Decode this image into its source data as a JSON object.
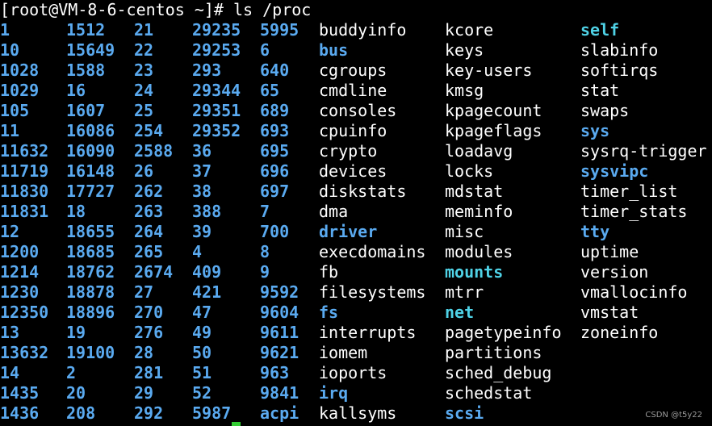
{
  "prompt": "[root@VM-8-6-centos ~]# ls /proc",
  "colors": {
    "directory": "#5aaaf0",
    "symlink": "#4fd2e6",
    "file": "#ffffff",
    "cursor": "#33cc33"
  },
  "rows": [
    [
      {
        "t": "1",
        "c": "blue"
      },
      {
        "t": "1512",
        "c": "blue"
      },
      {
        "t": "21",
        "c": "blue"
      },
      {
        "t": "29235",
        "c": "blue"
      },
      {
        "t": "5995",
        "c": "blue"
      },
      {
        "t": "buddyinfo",
        "c": "normal"
      },
      {
        "t": "kcore",
        "c": "normal"
      },
      {
        "t": "self",
        "c": "cyan"
      }
    ],
    [
      {
        "t": "10",
        "c": "blue"
      },
      {
        "t": "15649",
        "c": "blue"
      },
      {
        "t": "22",
        "c": "blue"
      },
      {
        "t": "29253",
        "c": "blue"
      },
      {
        "t": "6",
        "c": "blue"
      },
      {
        "t": "bus",
        "c": "blue"
      },
      {
        "t": "keys",
        "c": "normal"
      },
      {
        "t": "slabinfo",
        "c": "normal"
      }
    ],
    [
      {
        "t": "1028",
        "c": "blue"
      },
      {
        "t": "1588",
        "c": "blue"
      },
      {
        "t": "23",
        "c": "blue"
      },
      {
        "t": "293",
        "c": "blue"
      },
      {
        "t": "640",
        "c": "blue"
      },
      {
        "t": "cgroups",
        "c": "normal"
      },
      {
        "t": "key-users",
        "c": "normal"
      },
      {
        "t": "softirqs",
        "c": "normal"
      }
    ],
    [
      {
        "t": "1029",
        "c": "blue"
      },
      {
        "t": "16",
        "c": "blue"
      },
      {
        "t": "24",
        "c": "blue"
      },
      {
        "t": "29344",
        "c": "blue"
      },
      {
        "t": "65",
        "c": "blue"
      },
      {
        "t": "cmdline",
        "c": "normal"
      },
      {
        "t": "kmsg",
        "c": "normal"
      },
      {
        "t": "stat",
        "c": "normal"
      }
    ],
    [
      {
        "t": "105",
        "c": "blue"
      },
      {
        "t": "1607",
        "c": "blue"
      },
      {
        "t": "25",
        "c": "blue"
      },
      {
        "t": "29351",
        "c": "blue"
      },
      {
        "t": "689",
        "c": "blue"
      },
      {
        "t": "consoles",
        "c": "normal"
      },
      {
        "t": "kpagecount",
        "c": "normal"
      },
      {
        "t": "swaps",
        "c": "normal"
      }
    ],
    [
      {
        "t": "11",
        "c": "blue"
      },
      {
        "t": "16086",
        "c": "blue"
      },
      {
        "t": "254",
        "c": "blue"
      },
      {
        "t": "29352",
        "c": "blue"
      },
      {
        "t": "693",
        "c": "blue"
      },
      {
        "t": "cpuinfo",
        "c": "normal"
      },
      {
        "t": "kpageflags",
        "c": "normal"
      },
      {
        "t": "sys",
        "c": "blue"
      }
    ],
    [
      {
        "t": "11632",
        "c": "blue"
      },
      {
        "t": "16090",
        "c": "blue"
      },
      {
        "t": "2588",
        "c": "blue"
      },
      {
        "t": "36",
        "c": "blue"
      },
      {
        "t": "695",
        "c": "blue"
      },
      {
        "t": "crypto",
        "c": "normal"
      },
      {
        "t": "loadavg",
        "c": "normal"
      },
      {
        "t": "sysrq-trigger",
        "c": "normal"
      }
    ],
    [
      {
        "t": "11719",
        "c": "blue"
      },
      {
        "t": "16148",
        "c": "blue"
      },
      {
        "t": "26",
        "c": "blue"
      },
      {
        "t": "37",
        "c": "blue"
      },
      {
        "t": "696",
        "c": "blue"
      },
      {
        "t": "devices",
        "c": "normal"
      },
      {
        "t": "locks",
        "c": "normal"
      },
      {
        "t": "sysvipc",
        "c": "blue"
      }
    ],
    [
      {
        "t": "11830",
        "c": "blue"
      },
      {
        "t": "17727",
        "c": "blue"
      },
      {
        "t": "262",
        "c": "blue"
      },
      {
        "t": "38",
        "c": "blue"
      },
      {
        "t": "697",
        "c": "blue"
      },
      {
        "t": "diskstats",
        "c": "normal"
      },
      {
        "t": "mdstat",
        "c": "normal"
      },
      {
        "t": "timer_list",
        "c": "normal"
      }
    ],
    [
      {
        "t": "11831",
        "c": "blue"
      },
      {
        "t": "18",
        "c": "blue"
      },
      {
        "t": "263",
        "c": "blue"
      },
      {
        "t": "388",
        "c": "blue"
      },
      {
        "t": "7",
        "c": "blue"
      },
      {
        "t": "dma",
        "c": "normal"
      },
      {
        "t": "meminfo",
        "c": "normal"
      },
      {
        "t": "timer_stats",
        "c": "normal"
      }
    ],
    [
      {
        "t": "12",
        "c": "blue"
      },
      {
        "t": "18655",
        "c": "blue"
      },
      {
        "t": "264",
        "c": "blue"
      },
      {
        "t": "39",
        "c": "blue"
      },
      {
        "t": "700",
        "c": "blue"
      },
      {
        "t": "driver",
        "c": "blue"
      },
      {
        "t": "misc",
        "c": "normal"
      },
      {
        "t": "tty",
        "c": "blue"
      }
    ],
    [
      {
        "t": "1200",
        "c": "blue"
      },
      {
        "t": "18685",
        "c": "blue"
      },
      {
        "t": "265",
        "c": "blue"
      },
      {
        "t": "4",
        "c": "blue"
      },
      {
        "t": "8",
        "c": "blue"
      },
      {
        "t": "execdomains",
        "c": "normal"
      },
      {
        "t": "modules",
        "c": "normal"
      },
      {
        "t": "uptime",
        "c": "normal"
      }
    ],
    [
      {
        "t": "1214",
        "c": "blue"
      },
      {
        "t": "18762",
        "c": "blue"
      },
      {
        "t": "2674",
        "c": "blue"
      },
      {
        "t": "409",
        "c": "blue"
      },
      {
        "t": "9",
        "c": "blue"
      },
      {
        "t": "fb",
        "c": "normal"
      },
      {
        "t": "mounts",
        "c": "cyan"
      },
      {
        "t": "version",
        "c": "normal"
      }
    ],
    [
      {
        "t": "1230",
        "c": "blue"
      },
      {
        "t": "18878",
        "c": "blue"
      },
      {
        "t": "27",
        "c": "blue"
      },
      {
        "t": "421",
        "c": "blue"
      },
      {
        "t": "9592",
        "c": "blue"
      },
      {
        "t": "filesystems",
        "c": "normal"
      },
      {
        "t": "mtrr",
        "c": "normal"
      },
      {
        "t": "vmallocinfo",
        "c": "normal"
      }
    ],
    [
      {
        "t": "12350",
        "c": "blue"
      },
      {
        "t": "18896",
        "c": "blue"
      },
      {
        "t": "270",
        "c": "blue"
      },
      {
        "t": "47",
        "c": "blue"
      },
      {
        "t": "9604",
        "c": "blue"
      },
      {
        "t": "fs",
        "c": "blue"
      },
      {
        "t": "net",
        "c": "cyan"
      },
      {
        "t": "vmstat",
        "c": "normal"
      }
    ],
    [
      {
        "t": "13",
        "c": "blue"
      },
      {
        "t": "19",
        "c": "blue"
      },
      {
        "t": "276",
        "c": "blue"
      },
      {
        "t": "49",
        "c": "blue"
      },
      {
        "t": "9611",
        "c": "blue"
      },
      {
        "t": "interrupts",
        "c": "normal"
      },
      {
        "t": "pagetypeinfo",
        "c": "normal"
      },
      {
        "t": "zoneinfo",
        "c": "normal"
      }
    ],
    [
      {
        "t": "13632",
        "c": "blue"
      },
      {
        "t": "19100",
        "c": "blue"
      },
      {
        "t": "28",
        "c": "blue"
      },
      {
        "t": "50",
        "c": "blue"
      },
      {
        "t": "9621",
        "c": "blue"
      },
      {
        "t": "iomem",
        "c": "normal"
      },
      {
        "t": "partitions",
        "c": "normal"
      },
      {
        "t": "",
        "c": "normal"
      }
    ],
    [
      {
        "t": "14",
        "c": "blue"
      },
      {
        "t": "2",
        "c": "blue"
      },
      {
        "t": "281",
        "c": "blue"
      },
      {
        "t": "51",
        "c": "blue"
      },
      {
        "t": "963",
        "c": "blue"
      },
      {
        "t": "ioports",
        "c": "normal"
      },
      {
        "t": "sched_debug",
        "c": "normal"
      },
      {
        "t": "",
        "c": "normal"
      }
    ],
    [
      {
        "t": "1435",
        "c": "blue"
      },
      {
        "t": "20",
        "c": "blue"
      },
      {
        "t": "29",
        "c": "blue"
      },
      {
        "t": "52",
        "c": "blue"
      },
      {
        "t": "9841",
        "c": "blue"
      },
      {
        "t": "irq",
        "c": "blue"
      },
      {
        "t": "schedstat",
        "c": "normal"
      },
      {
        "t": "",
        "c": "normal"
      }
    ],
    [
      {
        "t": "1436",
        "c": "blue"
      },
      {
        "t": "208",
        "c": "blue"
      },
      {
        "t": "292",
        "c": "blue"
      },
      {
        "t": "5987",
        "c": "blue"
      },
      {
        "t": "acpi",
        "c": "blue"
      },
      {
        "t": "kallsyms",
        "c": "normal"
      },
      {
        "t": "scsi",
        "c": "blue"
      },
      {
        "t": "",
        "c": "normal"
      }
    ]
  ],
  "watermark": "CSDN @t5y22"
}
